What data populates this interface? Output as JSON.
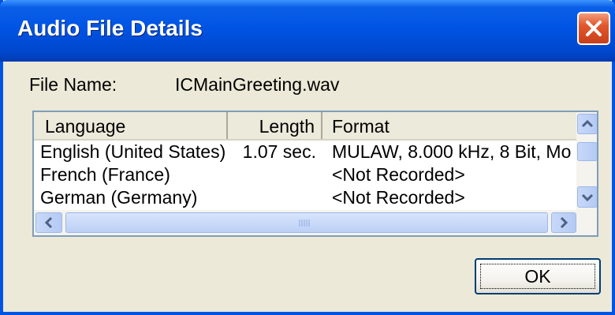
{
  "window": {
    "title": "Audio File Details"
  },
  "file": {
    "label": "File Name:",
    "value": "ICMainGreeting.wav"
  },
  "table": {
    "columns": [
      "Language",
      "Length",
      "Format"
    ],
    "rows": [
      [
        "English (United States)",
        "1.07 sec.",
        "MULAW, 8.000 kHz, 8 Bit, Mo"
      ],
      [
        "French (France)",
        "",
        "<Not Recorded>"
      ],
      [
        "German (Germany)",
        "",
        "<Not Recorded>"
      ]
    ]
  },
  "buttons": {
    "ok": "OK"
  },
  "icons": {
    "close": "close-icon",
    "scroll_up": "chevron-up-icon",
    "scroll_down": "chevron-down-icon",
    "scroll_left": "chevron-left-icon",
    "scroll_right": "chevron-right-icon"
  }
}
